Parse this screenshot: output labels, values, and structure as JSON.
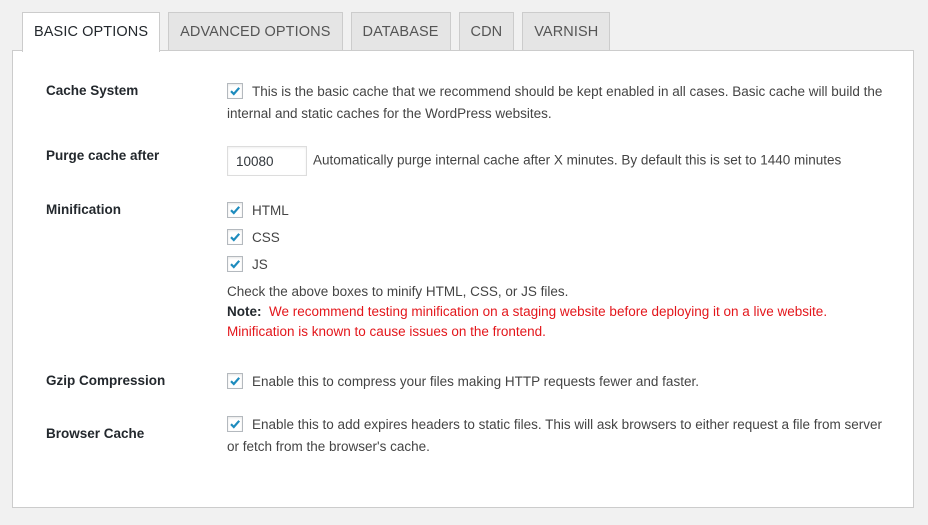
{
  "tabs": [
    {
      "label": "BASIC OPTIONS",
      "active": true
    },
    {
      "label": "ADVANCED OPTIONS",
      "active": false
    },
    {
      "label": "DATABASE",
      "active": false
    },
    {
      "label": "CDN",
      "active": false
    },
    {
      "label": "VARNISH",
      "active": false
    }
  ],
  "settings": {
    "cache_system": {
      "label": "Cache System",
      "checked": true,
      "description": "This is the basic cache that we recommend should be kept enabled in all cases. Basic cache will build the internal and static caches for the WordPress websites."
    },
    "purge_cache": {
      "label": "Purge cache after",
      "value": "10080",
      "description": "Automatically purge internal cache after X minutes. By default this is set to 1440 minutes"
    },
    "minification": {
      "label": "Minification",
      "options": [
        {
          "label": "HTML",
          "checked": true
        },
        {
          "label": "CSS",
          "checked": true
        },
        {
          "label": "JS",
          "checked": true
        }
      ],
      "help": "Check the above boxes to minify HTML, CSS, or JS files.",
      "note_label": "Note:",
      "note_text": "We recommend testing minification on a staging website before deploying it on a live website. Minification is known to cause issues on the frontend."
    },
    "gzip": {
      "label": "Gzip Compression",
      "checked": true,
      "description": "Enable this to compress your files making HTTP requests fewer and faster."
    },
    "browser_cache": {
      "label": "Browser Cache",
      "checked": true,
      "description": "Enable this to add expires headers to static files. This will ask browsers to either request a file from server or fetch from the browser's cache."
    }
  },
  "colors": {
    "checkmark": "#1e8cbe",
    "note": "#e3161b"
  }
}
